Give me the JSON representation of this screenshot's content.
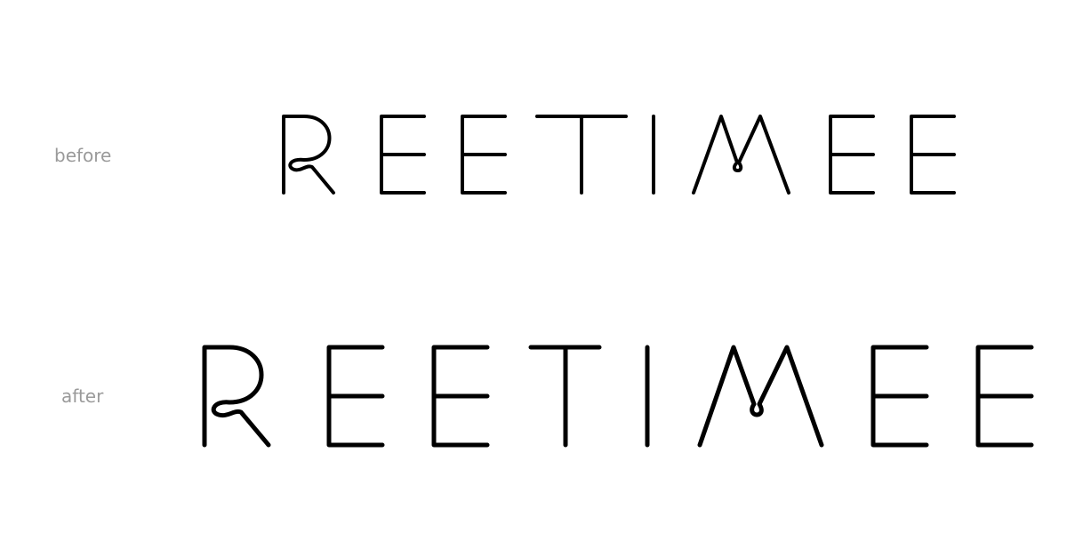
{
  "rows": [
    {
      "label": "before",
      "wordmark": "REETIMEE"
    },
    {
      "label": "after",
      "wordmark": "REETIMEE"
    }
  ],
  "colors": {
    "background": "#ffffff",
    "label": "#9a9a9a",
    "wordmark": "#000000"
  }
}
